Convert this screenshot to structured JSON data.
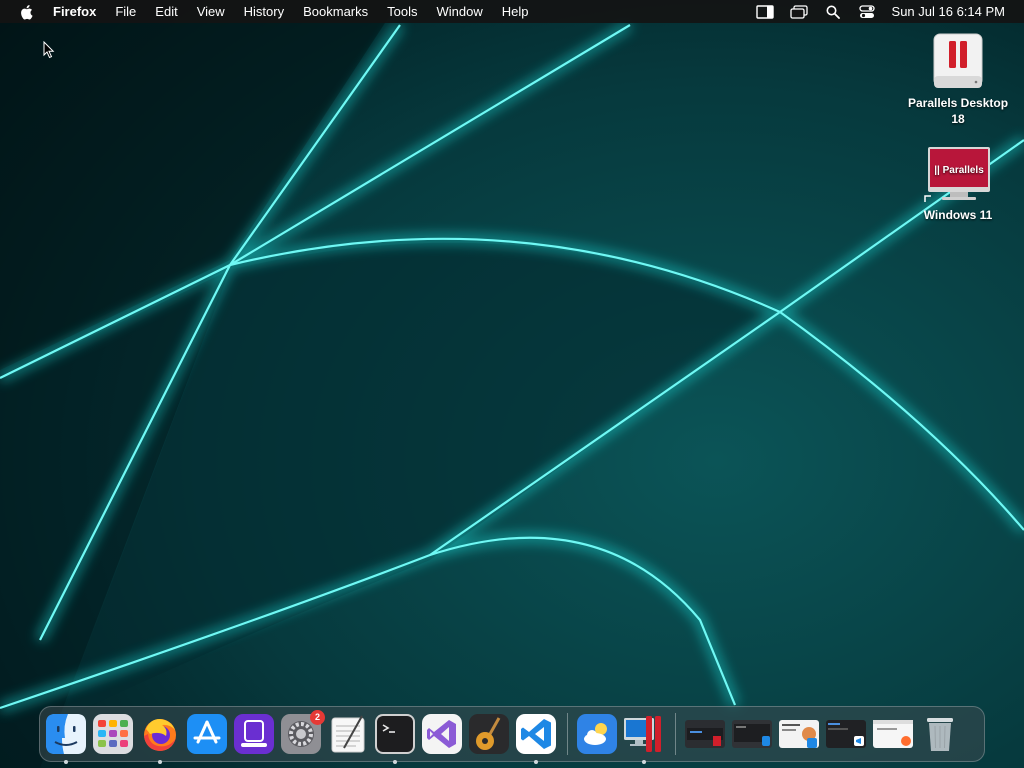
{
  "menubar": {
    "app_name": "Firefox",
    "items": [
      "File",
      "Edit",
      "View",
      "History",
      "Bookmarks",
      "Tools",
      "Window",
      "Help"
    ],
    "clock": "Sun Jul 16  6:14 PM",
    "status_icons": [
      "sidebar-icon",
      "window-icon",
      "spotlight-icon",
      "control-center-icon"
    ]
  },
  "desktop": {
    "icons": [
      {
        "name": "parallels-desktop-drive",
        "label_line1": "Parallels Desktop",
        "label_line2": "18"
      },
      {
        "name": "windows-11-vm",
        "label": "Windows 11",
        "screen_text": "|| Parallels"
      }
    ]
  },
  "dock": {
    "apps": [
      {
        "name": "finder",
        "running": true
      },
      {
        "name": "launchpad",
        "running": false
      },
      {
        "name": "firefox",
        "running": true
      },
      {
        "name": "app-store",
        "running": false
      },
      {
        "name": "apple-configurator",
        "running": false
      },
      {
        "name": "system-settings",
        "running": false,
        "badge": "2"
      },
      {
        "name": "textedit",
        "running": false
      },
      {
        "name": "terminal",
        "running": true
      },
      {
        "name": "visual-studio",
        "running": false
      },
      {
        "name": "garageband",
        "running": false
      },
      {
        "name": "vscode",
        "running": true
      },
      {
        "name": "weather",
        "running": false
      },
      {
        "name": "parallels-desktop",
        "running": true
      }
    ],
    "minimized_windows": [
      "window-1",
      "window-2",
      "window-3",
      "window-4",
      "window-5"
    ],
    "trash": "trash"
  },
  "colors": {
    "wallpaper_dark": "#021a1d",
    "wallpaper_glow": "#19e6e6",
    "parallels_red": "#c8102e"
  }
}
